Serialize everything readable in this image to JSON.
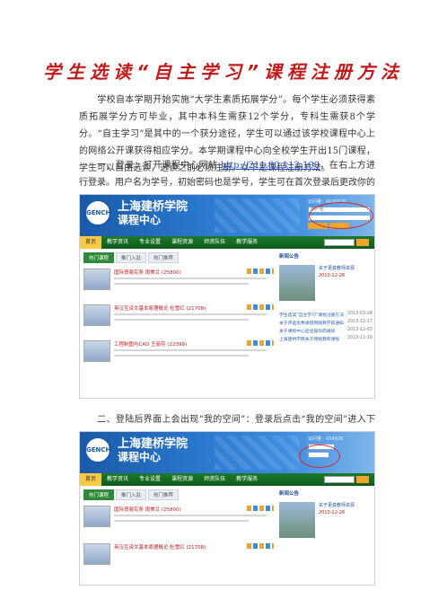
{
  "document": {
    "title": "学生选读“自主学习”课程注册方法",
    "para1": "学校自本学期开始实施“大学生素质拓展学分”。每个学生必须获得素质拓展学分方可毕业，其中本科生需获12个学分，专科生需获8个学分。“自主学习”是其中的一个获分途径，学生可以通过该学校课程中心上的网络公开课获得相应学分。本学期课程中心向全校学生开出15门课程，学生可以自由选读，选读之前必须注册。以下是课程注册方法。",
    "para2_before": "一、登录：打开课程中心网站 ",
    "para2_link": "http://211.80.112.100",
    "para2_after": "，在右上方进行登录。用户名为学号，初始密码也是学号，学生可在首次登录后更改你的密码。",
    "para3": "二、登陆后界面上会出现“我的空间”：登录后点击“我的空间”进入下一个界面。"
  },
  "screenshot1": {
    "school_name": "上海建桥学院",
    "center_name": "课程中心",
    "logo_text": "GENCH",
    "visitor_count": "访问量：4100026",
    "username_label": "用户名",
    "nav": [
      "首页",
      "教学资讯",
      "专业设置",
      "课程资源",
      "师资队伍",
      "教学服务"
    ],
    "tabs": [
      "热门课程",
      "推门入驻",
      "热门推荐"
    ],
    "courses": [
      {
        "name": "国际贸易实务  周美兰  (25800)"
      },
      {
        "name": "英汉互译文基本原理概论  杜雪红  (21708)"
      },
      {
        "name": "工程制图与CAD  王丽芬  (22399)"
      }
    ],
    "news_header": "新闻公告",
    "announcement_title": "关于更变教师资源",
    "announcement_date": "2010-12-28",
    "news_items": [
      {
        "text": "学生选读“自主学习”课程注册方法",
        "date": "2013-03-24"
      },
      {
        "text": "关于评选优秀课程网络教学的通知",
        "date": "2013-12-17"
      },
      {
        "text": "关于课程中心后台操作的通知",
        "date": "2013-12-03"
      },
      {
        "text": "上海建桥学院关于网络教育课程",
        "date": "2013-11-18"
      }
    ]
  },
  "screenshot2": {
    "school_name": "上海建桥学院",
    "center_name": "课程中心",
    "logo_text": "GENCH",
    "visitor_count": "访问量：434928",
    "nav": [
      "首页",
      "教学资讯",
      "专业设置",
      "课程资源",
      "师资队伍",
      "教学服务"
    ],
    "tabs": [
      "热门课程",
      "推门入驻",
      "热门推荐"
    ],
    "courses": [
      {
        "name": "国际贸易实务  周美兰  (25800)"
      },
      {
        "name": "英汉互译文基本原理概论  杜雪红  (21708)"
      }
    ],
    "news_header": "新闻公告",
    "announcement_title": "关于更变教师资源",
    "announcement_date": "2010-12-28"
  }
}
